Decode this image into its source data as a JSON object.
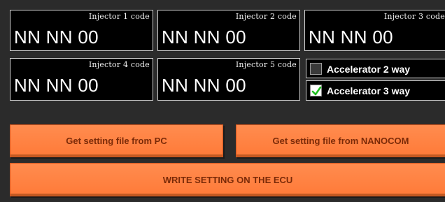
{
  "injectors": [
    {
      "label": "Injector 1 code",
      "value": "NN NN 00"
    },
    {
      "label": "Injector 2 code",
      "value": "NN NN 00"
    },
    {
      "label": "Injector 3 code",
      "value": "NN NN 00"
    },
    {
      "label": "Injector 4 code",
      "value": "NN NN 00"
    },
    {
      "label": "Injector 5 code",
      "value": "NN NN 00"
    }
  ],
  "options": [
    {
      "label": "Accelerator 2 way",
      "checked": false
    },
    {
      "label": "Accelerator 3 way",
      "checked": true
    }
  ],
  "buttons": {
    "from_pc": "Get setting file from PC",
    "from_nanocom": "Get setting file from NANOCOM",
    "write_ecu": "WRITE SETTING ON THE ECU"
  },
  "colors": {
    "button_bg": "#ff7f3f",
    "button_text": "#7a2a08",
    "field_bg": "#000000",
    "panel_bg": "#2b2b2b",
    "check_mark": "#1fbf1f"
  }
}
